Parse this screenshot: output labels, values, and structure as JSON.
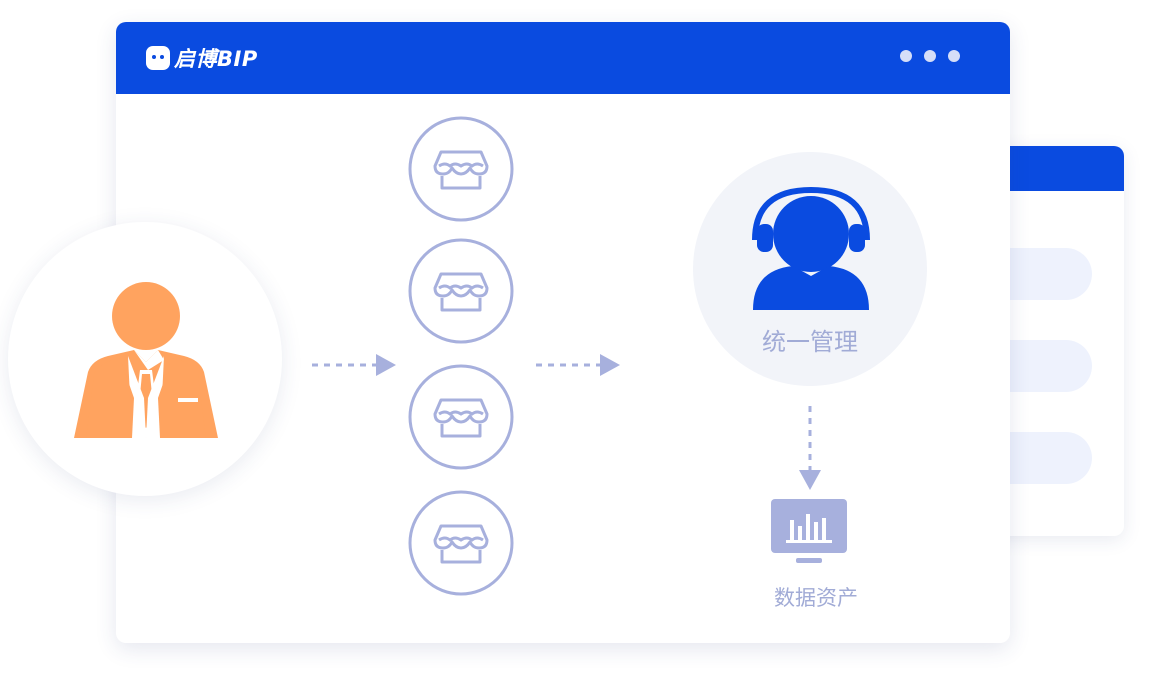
{
  "app": {
    "logo_text": "启博BIP"
  },
  "diagram": {
    "center_label": "统一管理",
    "output_label": "数据资产"
  },
  "colors": {
    "brand_blue": "#0a4be0",
    "person_orange": "#ffa35f",
    "line_lavender": "#a7b0dd",
    "label_gray": "#a1abd6"
  },
  "icons": {
    "person": "businessman-icon",
    "store": "store-icon",
    "support": "customer-service-headset-icon",
    "report": "bar-chart-monitor-icon"
  }
}
